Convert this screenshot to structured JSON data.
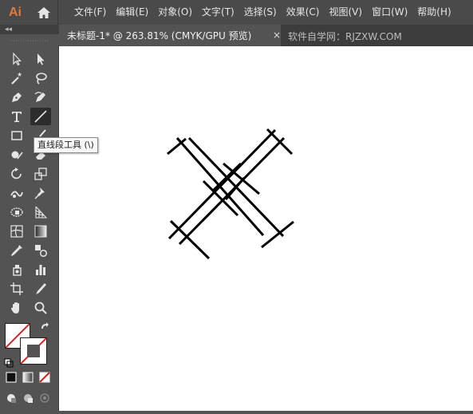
{
  "app": {
    "logo": "Ai"
  },
  "menu": [
    "文件(F)",
    "编辑(E)",
    "对象(O)",
    "文字(T)",
    "选择(S)",
    "效果(C)",
    "视图(V)",
    "窗口(W)",
    "帮助(H)"
  ],
  "document_tab": {
    "title": "未标题-1* @ 263.81% (CMYK/GPU 预览)",
    "close": "×"
  },
  "watermark": "软件自学网：RJZXW.COM",
  "toolbar": {
    "collapse": "◂◂",
    "tooltip": "直线段工具 (\\)"
  },
  "colors": {
    "accent": "#e07b39",
    "canvas": "#ffffff",
    "panel": "#535353"
  }
}
